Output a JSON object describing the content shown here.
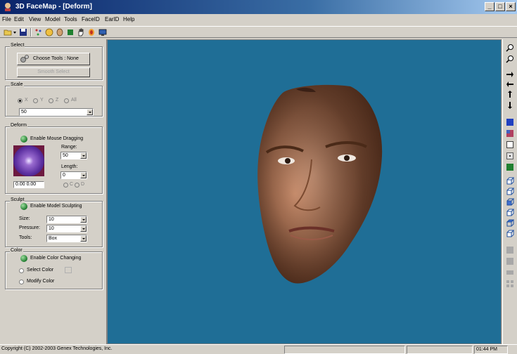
{
  "window": {
    "title": "3D FaceMap - [Deform]",
    "controls": {
      "minimize": "_",
      "maximize": "□",
      "close": "×"
    }
  },
  "menu": [
    "File",
    "Edit",
    "View",
    "Model",
    "Tools",
    "FaceID",
    "EarID",
    "Help"
  ],
  "toolbar": {
    "icons": [
      "open-icon",
      "dropdown-arrow-icon",
      "save-icon",
      "points-icon",
      "face-icon",
      "head-icon",
      "green-square-icon",
      "hand-icon",
      "color-head-icon",
      "screen-icon"
    ]
  },
  "select_panel": {
    "label": "Select",
    "choose_tools_button": "Choose Tools : None",
    "smooth_select_button": "Smooth Select"
  },
  "scale_panel": {
    "label": "Scale",
    "axes": [
      {
        "label": "X",
        "selected": true
      },
      {
        "label": "Y",
        "selected": false
      },
      {
        "label": "Z",
        "selected": false
      },
      {
        "label": "All",
        "selected": false
      }
    ],
    "value": "50"
  },
  "deform_panel": {
    "label": "Deform",
    "enable_label": "Enable Mouse Dragging",
    "range_label": "Range:",
    "range_value": "50",
    "length_label": "Length:",
    "length_value": "0",
    "coords": "0.00 0.00",
    "options": [
      {
        "label": "C",
        "selected": false
      },
      {
        "label": "D",
        "selected": false
      }
    ]
  },
  "sculpt_panel": {
    "label": "Sculpt",
    "enable_label": "Enable Model Sculpting",
    "size_label": "Size:",
    "size_value": "10",
    "pressure_label": "Pressure:",
    "pressure_value": "10",
    "tools_label": "Tools:",
    "tools_value": "Box"
  },
  "color_panel": {
    "label": "Color",
    "enable_label": "Enable Color Changing",
    "select_color_label": "Select Color",
    "modify_color_label": "Modify Color"
  },
  "right_toolbar": {
    "icons": [
      "zoom-in-icon",
      "zoom-out-icon",
      "arrow-right-icon",
      "arrow-left-icon",
      "arrow-up-icon",
      "arrow-down-icon",
      "solid-blue-square-icon",
      "textured-square-icon",
      "wireframe-square-icon",
      "points-square-icon",
      "green-square-icon",
      "cube-view-1-icon",
      "cube-view-2-icon",
      "cube-view-3-icon",
      "cube-view-4-icon",
      "cube-view-5-icon",
      "cube-view-6-icon",
      "gray-tool-1-icon",
      "gray-tool-2-icon",
      "gray-tool-3-icon",
      "gray-tool-4-icon"
    ]
  },
  "status": {
    "copyright": "Copyright (C) 2002-2003 Genex Technologies, Inc.",
    "time": "01:44 PM"
  },
  "colors": {
    "viewport_background": "#1f6e96",
    "titlebar": "#0a246a",
    "window_face": "#d4d0c8"
  }
}
